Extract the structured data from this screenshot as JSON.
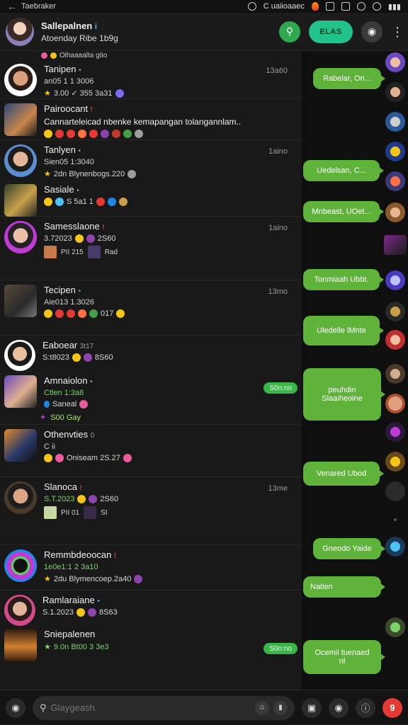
{
  "status": {
    "app": "Taebraker",
    "right_text": "C uaiioaaec"
  },
  "header": {
    "title": "Sallepalnen",
    "tag": "i",
    "subtitle": "Atoenday  Ribe 1b9g",
    "action_label": "ELAS"
  },
  "list_top": "Olhaaaalta gtio",
  "rows": [
    {
      "name": "Tanipen",
      "tag": "•",
      "time": "13a60",
      "meta": "an05  1  1 3006",
      "meta2": "3.00  ✓ 355 3a31"
    },
    {
      "name": "Pairoocant",
      "tag": "!",
      "time": "",
      "meta": "Cannarteleicad nbenke kemapangan tolangannlam..",
      "meta2": ""
    },
    {
      "name": "Tanlyen",
      "tag": "•",
      "time": "1aino",
      "meta": "Sien05  1:3040",
      "meta2": "2dn  Blynenbogs.220"
    },
    {
      "name": "Sasiale",
      "tag": "•",
      "time": "",
      "meta": "",
      "meta2": "S 5a1  1"
    },
    {
      "name": "Samesslaone",
      "tag": "!",
      "time": "1aino",
      "meta": "3.72023",
      "meta2": "2S60"
    },
    {
      "name": "Tecipen",
      "tag": "•",
      "time": "13mo",
      "meta": "Aie013  1.3026",
      "meta2": "017"
    },
    {
      "name": "Eaboear",
      "tag": "3t17",
      "time": "",
      "meta": "S:t8023",
      "meta2": "8S60"
    },
    {
      "name": "Amnaiolon",
      "tag": "•",
      "time": "",
      "meta": "Ctlen  1:3a8",
      "meta2": "Saneal",
      "badge": "S0n:no"
    },
    {
      "name": "Othenvties",
      "tag": "0",
      "time": "",
      "meta": "C ii",
      "meta2": "Oniseam  2S.27"
    },
    {
      "name": "Slanoca",
      "tag": "!",
      "time": "13me",
      "meta": "S.T.2023",
      "meta2": "2S60"
    },
    {
      "name": "Remmbdeoocan",
      "tag": "!",
      "time": "",
      "meta": "1e0e1:1  2 3a10",
      "meta2": "2du  Blymencoep.2a40"
    },
    {
      "name": "Ramlaraiane",
      "tag": "•",
      "time": "",
      "meta": "S.1.2023",
      "meta2": "8S63"
    },
    {
      "name": "Sniepalenen",
      "tag": "",
      "time": "",
      "meta": "9.0n  Bt00  3 3e3",
      "meta2": "",
      "badge": "S0n:no"
    }
  ],
  "green_line": "S00  Gay",
  "bubbles": [
    "Rabelar, On...",
    "Uedelsan, C...",
    "Mnbeast, UOet...",
    "Tonmlaah Ubbt.",
    "Uledelle lMnte",
    "peuhdin\nSlaaiheoine",
    "Venared Ubod",
    "Gneodo Yaide",
    "Natlen",
    "Ocemil tuenaed\nnl"
  ],
  "bottom": {
    "search_placeholder": "Glaygeash.",
    "notif_count": "9"
  },
  "colors": {
    "bubble": "#5fb33a",
    "accent_pill": "#22c38a",
    "badge": "#39b54a"
  }
}
